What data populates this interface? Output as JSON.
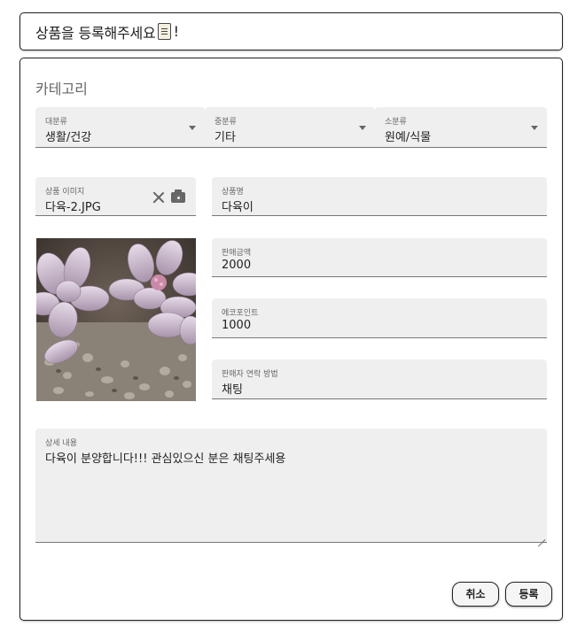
{
  "header": {
    "title": "상품을 등록해주세요",
    "title_suffix": "!",
    "emoji": "scroll-icon"
  },
  "form": {
    "section_title": "카테고리",
    "category": {
      "major": {
        "label": "대분류",
        "value": "생활/건강"
      },
      "middle": {
        "label": "중분류",
        "value": "기타"
      },
      "minor": {
        "label": "소분류",
        "value": "원예/식물"
      }
    },
    "image_field": {
      "label": "상품 이미지",
      "value": "다육-2.JPG"
    },
    "product_name": {
      "label": "상품명",
      "value": "다육이"
    },
    "price": {
      "label": "판매금액",
      "value": "2000"
    },
    "eco_points": {
      "label": "에코포인트",
      "value": "1000"
    },
    "contact_method": {
      "label": "판매자 연락 방법",
      "value": "채팅"
    },
    "description": {
      "label": "상세 내용",
      "value": "다육이 분양합니다!!! 관심있으신 분은 채팅주세용"
    }
  },
  "buttons": {
    "cancel": "취소",
    "submit": "등록"
  },
  "colors": {
    "field_bg": "#efefef",
    "border": "#222222",
    "label": "#666666"
  }
}
